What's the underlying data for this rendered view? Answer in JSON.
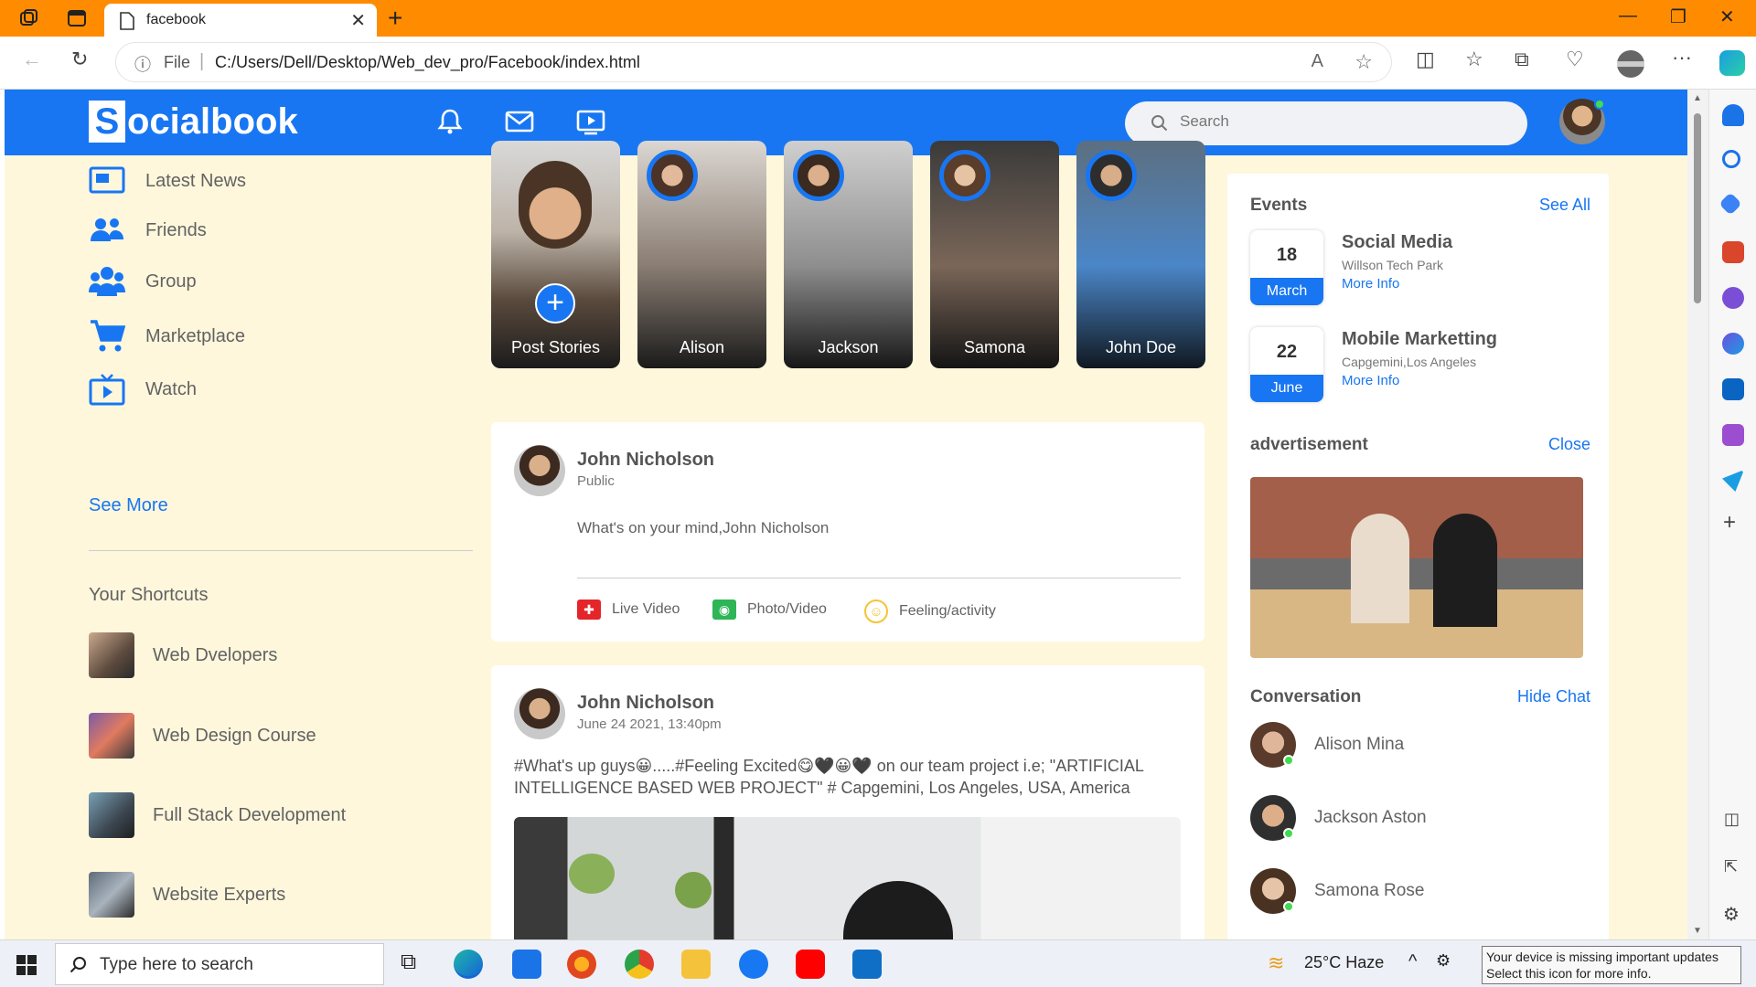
{
  "browser": {
    "tab_title": "facebook",
    "address_scheme": "File",
    "address_url": "C:/Users/Dell/Desktop/Web_dev_pro/Facebook/index.html"
  },
  "navbar": {
    "logo_letter": "S",
    "logo_rest": "ocialbook",
    "search_placeholder": "Search",
    "brand_color": "#1876f2"
  },
  "sidebar": {
    "items": [
      {
        "label": "Latest News",
        "icon": "news-icon"
      },
      {
        "label": "Friends",
        "icon": "friends-icon"
      },
      {
        "label": "Group",
        "icon": "group-icon"
      },
      {
        "label": "Marketplace",
        "icon": "cart-icon"
      },
      {
        "label": "Watch",
        "icon": "watch-icon"
      }
    ],
    "see_more": "See More",
    "shortcuts_title": "Your Shortcuts",
    "shortcuts": [
      {
        "label": "Web Dvelopers"
      },
      {
        "label": "Web Design Course"
      },
      {
        "label": "Full Stack Development"
      },
      {
        "label": "Website Experts"
      }
    ]
  },
  "stories": [
    {
      "name": "Post Stories"
    },
    {
      "name": "Alison"
    },
    {
      "name": "Jackson"
    },
    {
      "name": "Samona"
    },
    {
      "name": "John Doe"
    }
  ],
  "create_post": {
    "user_name": "John Nicholson",
    "privacy": "Public",
    "placeholder": "What's on your mind,John Nicholson",
    "actions": [
      {
        "label": "Live Video"
      },
      {
        "label": "Photo/Video"
      },
      {
        "label": "Feeling/activity"
      }
    ]
  },
  "post": {
    "user_name": "John Nicholson",
    "timestamp": "June 24 2021, 13:40pm",
    "text_line1": "#What's up guys😀.....#Feeling Excited😋🖤😀🖤 on our team project i.e; \"ARTIFICIAL",
    "text_line2": "INTELLIGENCE BASED WEB PROJECT\" # Capgemini, Los Angeles, USA, America"
  },
  "right": {
    "events_title": "Events",
    "see_all": "See All",
    "events": [
      {
        "day": "18",
        "month": "March",
        "title": "Social Media",
        "location": "Willson Tech Park",
        "more": "More Info"
      },
      {
        "day": "22",
        "month": "June",
        "title": "Mobile Marketting",
        "location": "Capgemini,Los Angeles",
        "more": "More Info"
      }
    ],
    "ad_title": "advertisement",
    "ad_close": "Close",
    "conversation_title": "Conversation",
    "hide_chat": "Hide Chat",
    "conversations": [
      {
        "name": "Alison Mina"
      },
      {
        "name": "Jackson Aston"
      },
      {
        "name": "Samona Rose"
      }
    ]
  },
  "taskbar": {
    "search_text": "Type here to search",
    "weather": "25°C  Haze",
    "tooltip_line1": "Your device is missing important updates",
    "tooltip_line2": "Select this icon for more info."
  }
}
